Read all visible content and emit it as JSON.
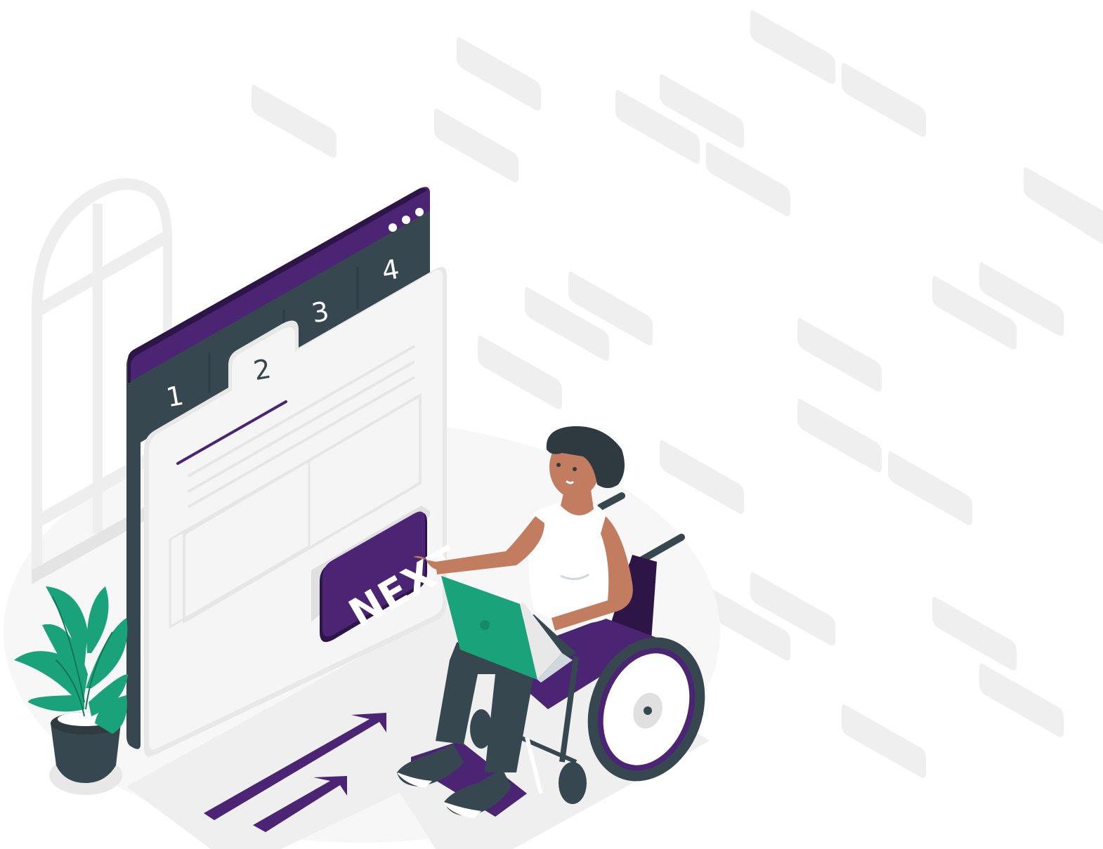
{
  "browser": {
    "tabs": [
      {
        "label": "1"
      },
      {
        "label": "2"
      },
      {
        "label": "3"
      },
      {
        "label": "4"
      }
    ],
    "active_tab": "2",
    "menu_icon": "ellipsis-icon"
  },
  "next_button": {
    "label": "NEXT"
  },
  "icons": {
    "arrows": "arrow-up-right-icon",
    "plant": "potted-plant-icon",
    "window": "arched-window-icon"
  },
  "colors": {
    "accent": "#4b2574",
    "accent_dark": "#2d1547",
    "dark": "#37474f",
    "laptop": "#1aa37a",
    "plant": "#1aa37a",
    "skin": "#c27c5f",
    "hair": "#2e3a3f",
    "background_shape": "#efefef"
  }
}
